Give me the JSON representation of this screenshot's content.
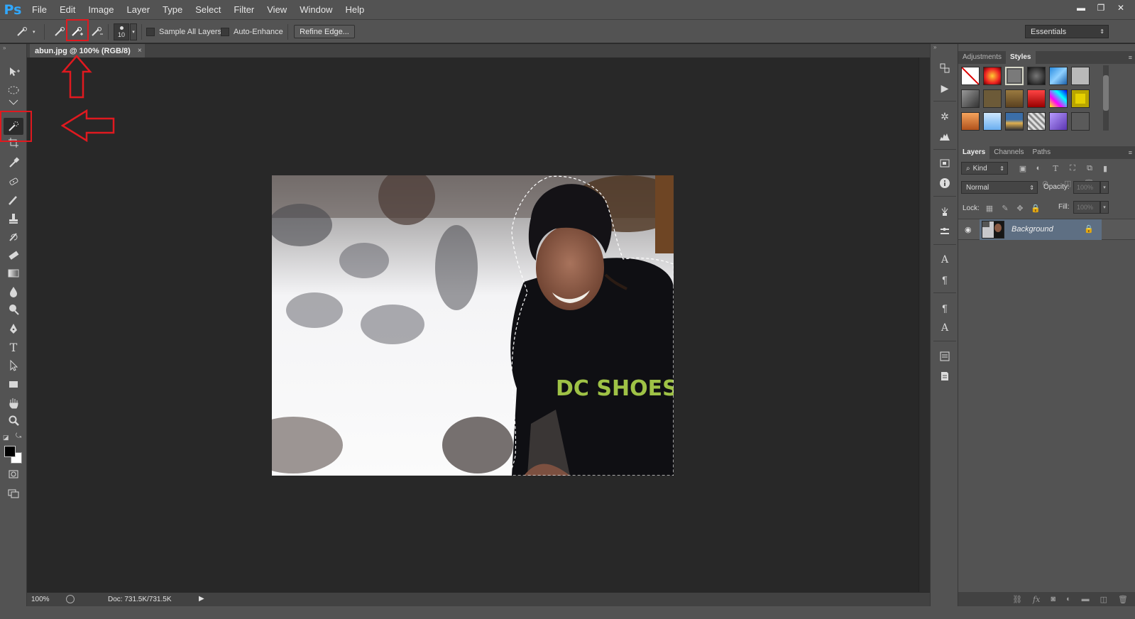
{
  "app": {
    "logo": "Ps"
  },
  "menu": [
    "File",
    "Edit",
    "Image",
    "Layer",
    "Type",
    "Select",
    "Filter",
    "View",
    "Window",
    "Help"
  ],
  "window_controls": {
    "minimize": "▬",
    "restore": "❐",
    "close": "✕"
  },
  "options": {
    "brush_size": "10",
    "sample_all_layers": "Sample All Layers",
    "auto_enhance": "Auto-Enhance",
    "refine_edge": "Refine Edge...",
    "workspace": "Essentials"
  },
  "document": {
    "tab_title": "abun.jpg @ 100% (RGB/8)",
    "tab_close": "×",
    "zoom": "100%",
    "doc_size": "Doc: 731.5K/731.5K"
  },
  "panels": {
    "top_tabs": [
      "Adjustments",
      "Styles"
    ],
    "layers_tabs": [
      "Layers",
      "Channels",
      "Paths"
    ],
    "filter_kind": "Kind",
    "blend_mode": "Normal",
    "opacity_label": "Opacity:",
    "opacity_value": "100%",
    "lock_label": "Lock:",
    "fill_label": "Fill:",
    "fill_value": "100%",
    "layer_name": "Background"
  },
  "colors": {
    "accent": "#31a8ff",
    "annotation_red": "#e0191f",
    "foreground": "#000000",
    "background": "#ffffff"
  }
}
